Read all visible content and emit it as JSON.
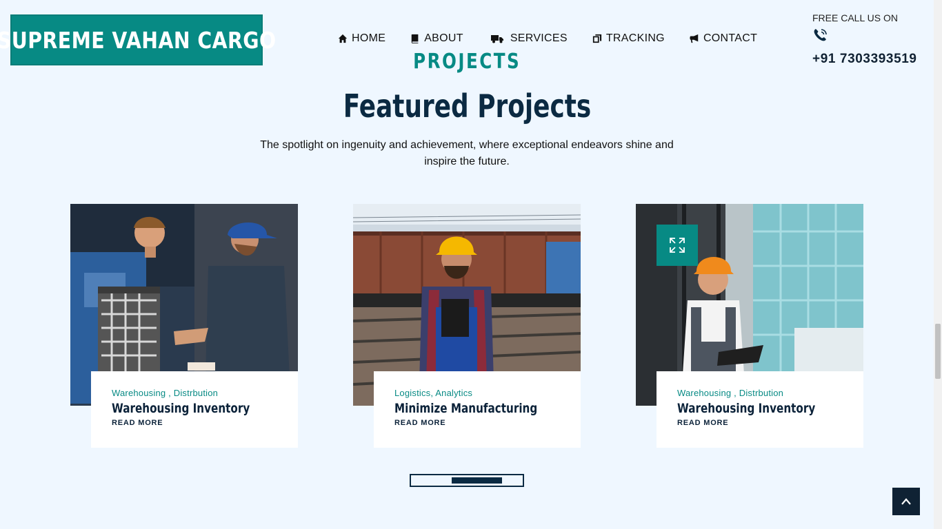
{
  "brand": {
    "logo_text": "SUPREME VAHAN CARGO"
  },
  "nav": [
    {
      "label": "HOME",
      "icon": "home-icon"
    },
    {
      "label": "ABOUT",
      "icon": "book-icon"
    },
    {
      "label": "SERVICES",
      "icon": "truck-icon"
    },
    {
      "label": "TRACKING",
      "icon": "box-icon"
    },
    {
      "label": "CONTACT",
      "icon": "megaphone-icon"
    }
  ],
  "contact": {
    "label": "FREE CALL US ON",
    "phone": "+91 7303393519",
    "icon": "phone-icon"
  },
  "section": {
    "tag": "PROJECTS",
    "title": "Featured Projects",
    "subtitle": "The spotlight on ingenuity and achievement, where exceptional endeavors shine and inspire the future."
  },
  "projects": [
    {
      "categories": "Warehousing , Distrbution",
      "title": "Warehousing Inventory",
      "link": "READ MORE"
    },
    {
      "categories": "Logistics, Analytics",
      "title": "Minimize Manufacturing",
      "link": "READ MORE"
    },
    {
      "categories": "Warehousing , Distrbution",
      "title": "Warehousing Inventory",
      "link": "READ MORE"
    }
  ],
  "colors": {
    "accent": "#078a84",
    "navy": "#0b2239",
    "background": "#eff7ff"
  }
}
